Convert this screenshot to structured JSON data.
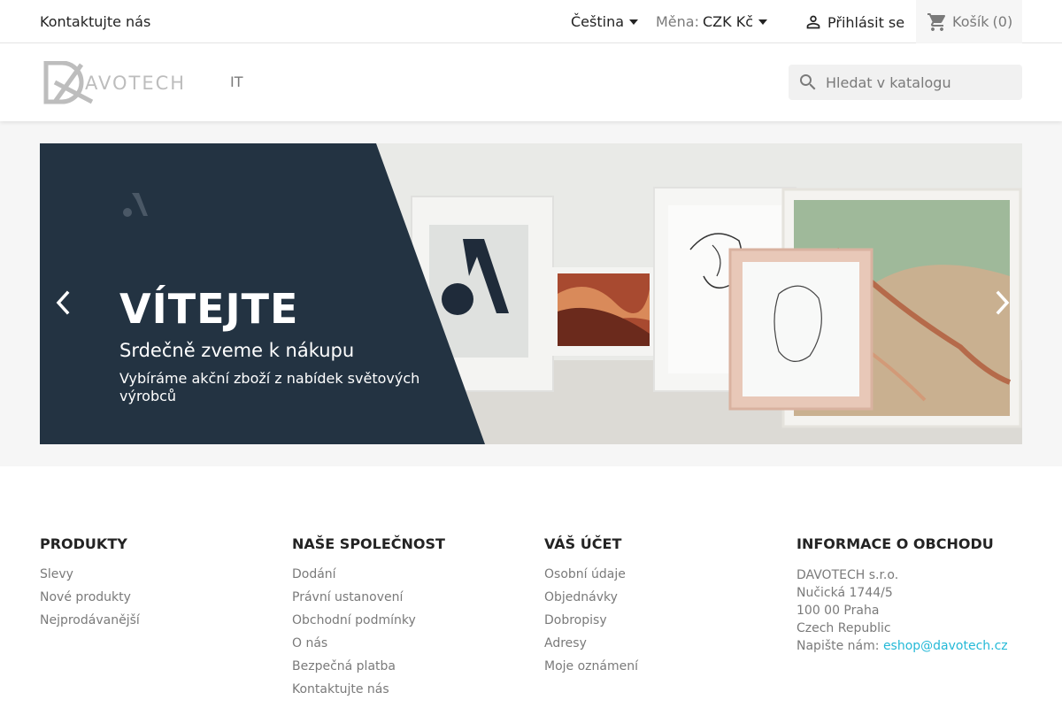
{
  "topbar": {
    "contact": "Kontaktujte nás",
    "language": "Čeština",
    "currency_label": "Měna:",
    "currency_value": "CZK Kč",
    "login": "Přihlásit se",
    "cart_label": "Košík",
    "cart_count": "(0)"
  },
  "header": {
    "logo_text": "AVOTECH",
    "nav_item": "IT",
    "search_placeholder": "Hledat v katalogu"
  },
  "slider": {
    "title": "VÍTEJTE",
    "subtitle": "Srdečně zveme k nákupu",
    "description": "Vybíráme akční zboží z nabídek světových výrobců"
  },
  "footer": {
    "products": {
      "heading": "PRODUKTY",
      "links": [
        "Slevy",
        "Nové produkty",
        "Nejprodávanější"
      ]
    },
    "company": {
      "heading": "NAŠE SPOLEČNOST",
      "links": [
        "Dodání",
        "Právní ustanovení",
        "Obchodní podmínky",
        "O nás",
        "Bezpečná platba",
        "Kontaktujte nás"
      ]
    },
    "account": {
      "heading": "VÁŠ ÚČET",
      "links": [
        "Osobní údaje",
        "Objednávky",
        "Dobropisy",
        "Adresy",
        "Moje oznámení"
      ]
    },
    "store_info": {
      "heading": "INFORMACE O OBCHODU",
      "lines": [
        "DAVOTECH s.r.o.",
        "Nučická 1744/5",
        "100 00 Praha",
        "Czech Republic"
      ],
      "write_us_label": "Napište nám:",
      "email": "eshop@davotech.cz"
    }
  },
  "colors": {
    "accent": "#24b9d7",
    "dark_panel": "#233342",
    "muted_text": "#7a7a7a"
  }
}
